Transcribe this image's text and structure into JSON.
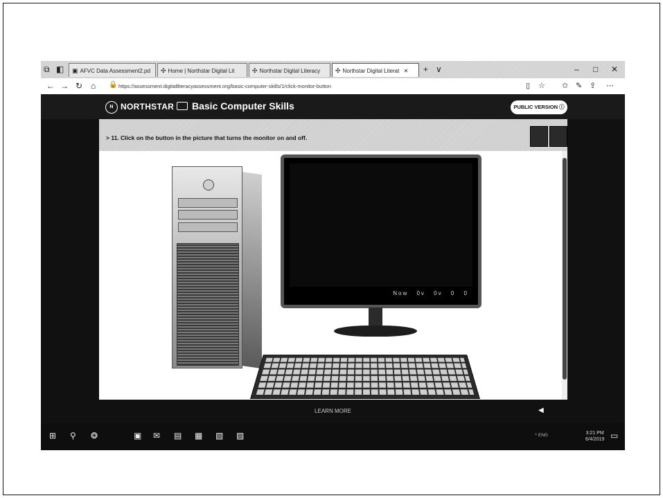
{
  "browser": {
    "tabs": [
      {
        "label": "AFVC Data Assessment2.pd",
        "icon": "pdf-icon"
      },
      {
        "label": "Home | Northstar Digital Lit",
        "icon": "northstar-icon"
      },
      {
        "label": "Northstar Digital Literacy",
        "icon": "northstar-icon"
      },
      {
        "label": "Northstar Digital Literat",
        "icon": "northstar-icon",
        "active": true
      }
    ],
    "new_tab": "+",
    "tab_menu": "∨",
    "window_controls": {
      "minimize": "–",
      "maximize": "□",
      "close": "✕"
    },
    "url": "https://assessment.digitalliteracyassessment.org/basic-computer-skills/1/click-monitor-button"
  },
  "header": {
    "logo": "NORTHSTAR",
    "logo_mark": "N",
    "course": "Basic Computer Skills",
    "public_version": "PUBLIC VERSION"
  },
  "question": {
    "text": "> 11. Click on the button in the picture that turns the monitor on and off."
  },
  "monitor": {
    "buttons": [
      "Now",
      "0v",
      "0v",
      "0",
      "0"
    ]
  },
  "footer": {
    "learn_more": "LEARN MORE"
  },
  "taskbar": {
    "tray_text": "^ ENG",
    "clock_time": "3:21 PM",
    "clock_date": "6/4/2019"
  }
}
